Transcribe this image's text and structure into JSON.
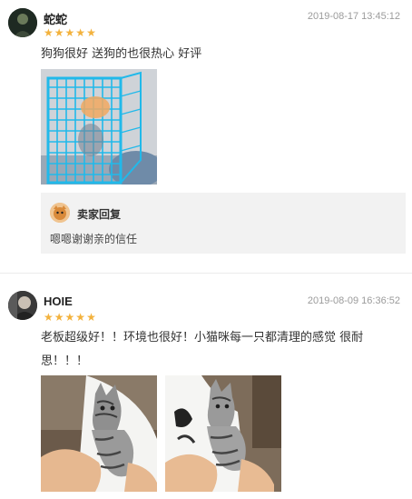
{
  "reviews": [
    {
      "name": "蛇蛇",
      "time": "2019-08-17 13:45:12",
      "rating": 5,
      "text": "狗狗很好 送狗的也很热心 好评",
      "reply": {
        "title": "卖家回复",
        "text": "嗯嗯谢谢亲的信任"
      }
    },
    {
      "name": "HOIE",
      "time": "2019-08-09 16:36:52",
      "rating": 5,
      "text_line1": "老板超级好！！环境也很好！小猫咪每一只都清理的感觉 很耐",
      "text_line2": "思！！！"
    }
  ],
  "colors": {
    "star": "#f3b23d",
    "cage": "#1fb8e8",
    "reply_bg": "#f2f2f2"
  }
}
